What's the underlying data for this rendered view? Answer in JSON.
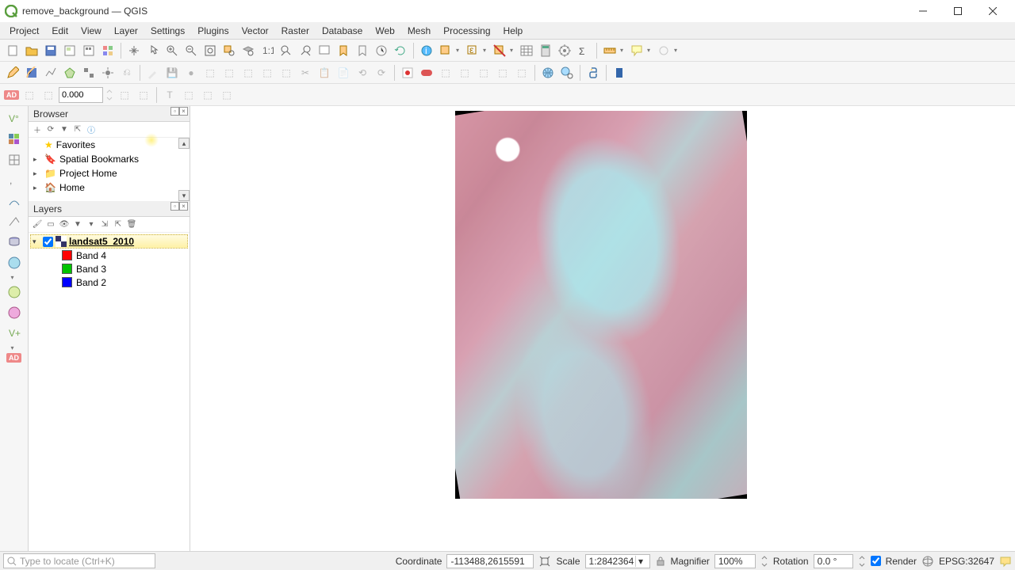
{
  "window": {
    "title": "remove_background — QGIS"
  },
  "menu": [
    "Project",
    "Edit",
    "View",
    "Layer",
    "Settings",
    "Plugins",
    "Vector",
    "Raster",
    "Database",
    "Web",
    "Mesh",
    "Processing",
    "Help"
  ],
  "spin_value": "0.000",
  "browser": {
    "title": "Browser",
    "items": [
      {
        "label": "Favorites",
        "icon": "star"
      },
      {
        "label": "Spatial Bookmarks",
        "icon": "bookmark"
      },
      {
        "label": "Project Home",
        "icon": "folder"
      },
      {
        "label": "Home",
        "icon": "home"
      }
    ]
  },
  "layers": {
    "title": "Layers",
    "active_layer": "landsat5_2010",
    "bands": [
      {
        "label": "Band 4",
        "color": "#ff0000"
      },
      {
        "label": "Band 3",
        "color": "#00c400"
      },
      {
        "label": "Band 2",
        "color": "#0000ff"
      }
    ]
  },
  "status": {
    "locator_placeholder": "Type to locate (Ctrl+K)",
    "coord_label": "Coordinate",
    "coord_value": "-113488,2615591",
    "scale_label": "Scale",
    "scale_value": "1:2842364",
    "mag_label": "Magnifier",
    "mag_value": "100%",
    "rot_label": "Rotation",
    "rot_value": "0.0 °",
    "render_label": "Render",
    "crs": "EPSG:32647"
  }
}
